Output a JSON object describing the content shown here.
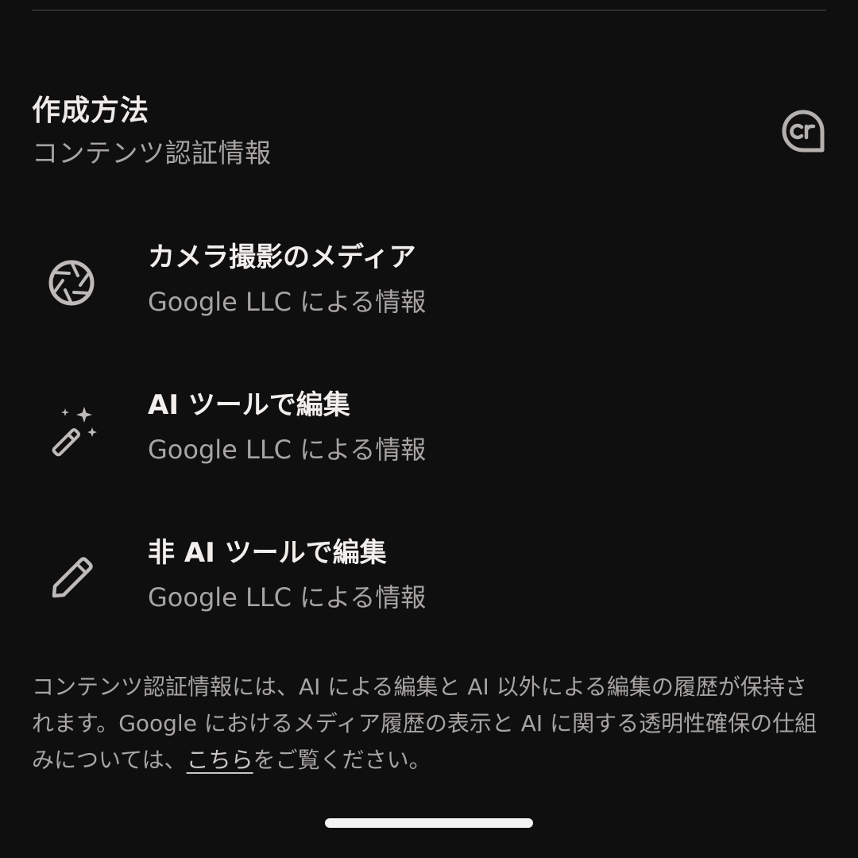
{
  "section": {
    "title": "作成方法",
    "subtitle": "コンテンツ認証情報",
    "badge_icon": "content-credentials-cr-icon"
  },
  "rows": [
    {
      "icon": "camera-aperture-icon",
      "title": "カメラ撮影のメディア",
      "subtitle": "Google LLC による情報"
    },
    {
      "icon": "magic-wand-sparkle-icon",
      "title": "AI ツールで編集",
      "subtitle": "Google LLC による情報"
    },
    {
      "icon": "pencil-icon",
      "title": "非 AI ツールで編集",
      "subtitle": "Google LLC による情報"
    }
  ],
  "footer": {
    "text_before_link": "コンテンツ認証情報には、AI による編集と AI 以外による編集の履歴が保持されます。Google におけるメディア履歴の表示と AI に関する透明性確保の仕組みについては、",
    "link_text": "こちら",
    "text_after_link": "をご覧ください。"
  },
  "colors": {
    "background": "#0f0f10",
    "primary_text": "#f1eeeb",
    "secondary_text": "#a7a4a2",
    "icon": "#bdbab8"
  }
}
